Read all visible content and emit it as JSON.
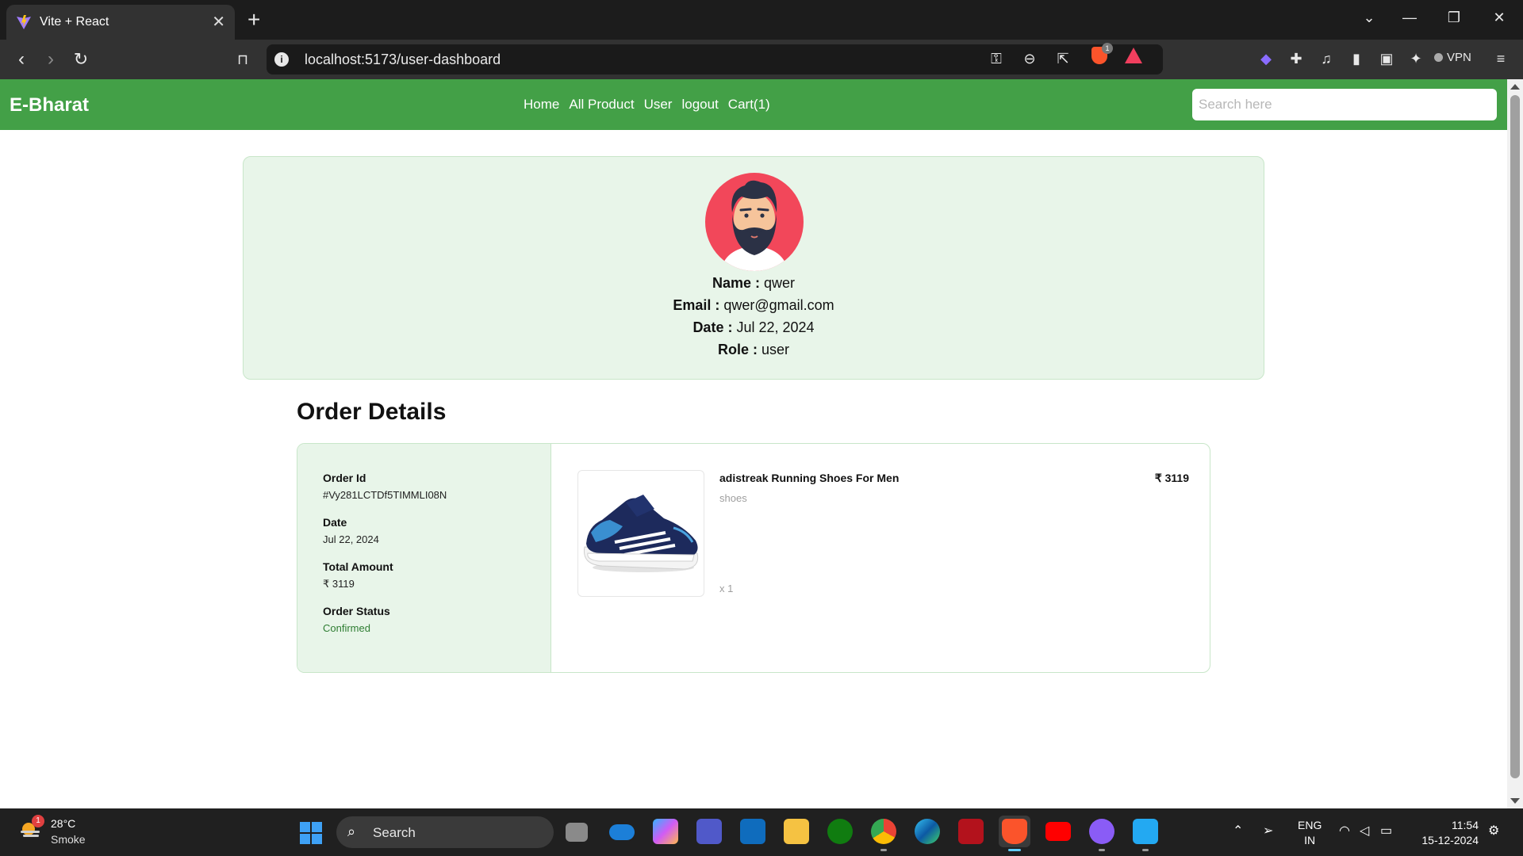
{
  "browser": {
    "tab_title": "Vite + React",
    "tab_close": "✕",
    "new_tab": "+",
    "url": "localhost:5173/user-dashboard",
    "shield_badge": "1",
    "vpn_label": "VPN"
  },
  "site": {
    "brand": "E-Bharat",
    "nav": [
      "Home",
      "All Product",
      "User",
      "logout",
      "Cart(1)"
    ],
    "search_placeholder": "Search here",
    "accent_color": "#43a047"
  },
  "profile": {
    "name_label": "Name :",
    "name": "qwer",
    "email_label": "Email :",
    "email": "qwer@gmail.com",
    "date_label": "Date :",
    "date": "Jul 22, 2024",
    "role_label": "Role :",
    "role": "user"
  },
  "orders": {
    "heading": "Order Details",
    "order_id_label": "Order Id",
    "order_id": "#Vy281LCTDf5TIMMLI08N",
    "date_label": "Date",
    "date": "Jul 22, 2024",
    "total_label": "Total Amount",
    "total": "₹ 3119",
    "status_label": "Order Status",
    "status": "Confirmed",
    "item": {
      "name": "adistreak Running Shoes For Men",
      "category": "shoes",
      "quantity": "x 1",
      "price": "₹ 3119"
    }
  },
  "taskbar": {
    "weather_badge": "1",
    "temperature": "28°C",
    "condition": "Smoke",
    "search_label": "Search",
    "lang_line1": "ENG",
    "lang_line2": "IN",
    "time": "11:54",
    "date": "15-12-2024"
  }
}
